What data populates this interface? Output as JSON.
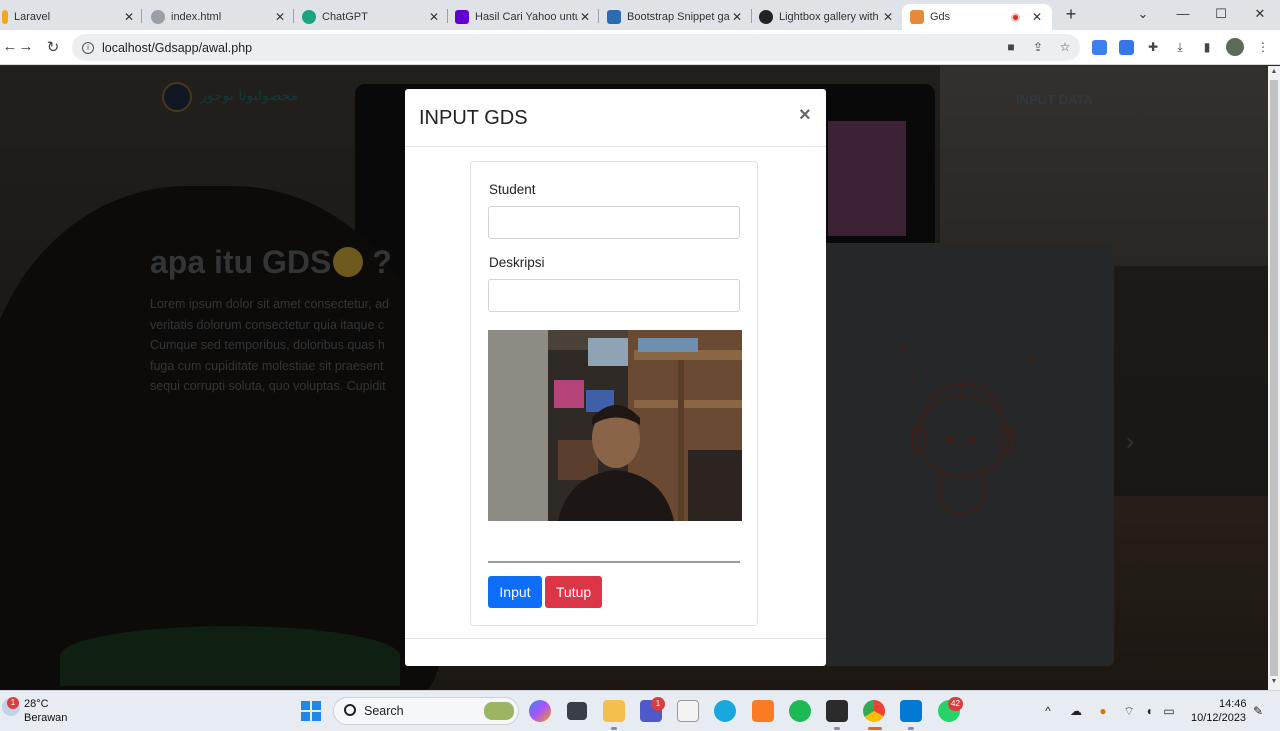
{
  "browser": {
    "tabs": [
      {
        "title": "Laravel",
        "icon_color": "#f4a623"
      },
      {
        "title": "index.html",
        "icon_color": "#9aa0a6"
      },
      {
        "title": "ChatGPT",
        "icon_color": "#19a37f"
      },
      {
        "title": "Hasil Cari Yahoo untuk",
        "icon_color": "#5f01d1"
      },
      {
        "title": "Bootstrap Snippet ga",
        "icon_color": "#2b6cb0"
      },
      {
        "title": "Lightbox gallery with",
        "icon_color": "#222222"
      },
      {
        "title": "Gds",
        "icon_color": "#e8883a"
      }
    ],
    "new_tab": "+",
    "window_controls": {
      "minimize": "—",
      "maximize": "☐",
      "close": "✕",
      "tab_search": "⌄"
    },
    "url": "localhost/Gdsapp/awal.php"
  },
  "site": {
    "logo_text": "محصوليونا يوجور",
    "nav_link": "INPUT DATA",
    "hero_title": "apa itu GDS",
    "hero_suffix": " ?",
    "hero_text": "Lorem ipsum dolor sit amet consectetur, ad\nveritatis dolorum consectetur quia itaque c\nCumque sed temporibus, doloribus quas h\nfuga cum cupiditate molestiae sit praesent\nsequi corrupti soluta, quo voluptas. Cupidit",
    "gallery_next": "›"
  },
  "modal": {
    "title": "INPUT GDS",
    "close": "×",
    "student_label": "Student",
    "student_value": "",
    "deskripsi_label": "Deskripsi",
    "deskripsi_value": "",
    "input_button": "Input",
    "tutup_button": "Tutup"
  },
  "taskbar": {
    "weather_badge": "1",
    "weather_temp": "28°C",
    "weather_desc": "Berawan",
    "search_label": "Search",
    "teams_badge": "1",
    "whatsapp_badge": "42",
    "time": "14:46",
    "date": "10/12/2023"
  },
  "colors": {
    "primary": "#0d6efd",
    "danger": "#dc3545",
    "recording": "#d93025"
  }
}
